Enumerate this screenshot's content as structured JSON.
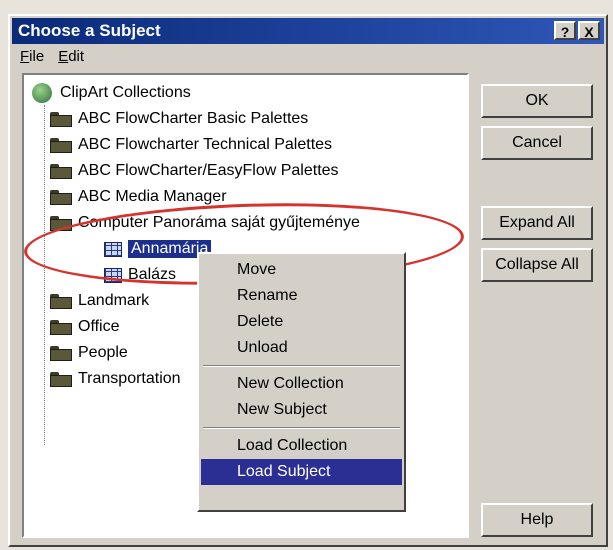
{
  "window": {
    "title": "Choose a Subject",
    "help_btn": "?",
    "close_btn": "X"
  },
  "menu": {
    "file": "File",
    "edit": "Edit"
  },
  "tree": {
    "root": "ClipArt Collections",
    "items": [
      "ABC FlowCharter Basic Palettes",
      "ABC Flowcharter Technical Palettes",
      "ABC FlowCharter/EasyFlow Palettes",
      "ABC Media Manager",
      "Computer Panoráma saját gyűjteménye",
      "Annamária",
      "Balázs",
      "Landmark",
      "Office",
      "People",
      "Transportation"
    ]
  },
  "context_menu": [
    "Move",
    "Rename",
    "Delete",
    "Unload",
    "New Collection",
    "New Subject",
    "Load Collection",
    "Load Subject"
  ],
  "buttons": {
    "ok": "OK",
    "cancel": "Cancel",
    "expand": "Expand All",
    "collapse": "Collapse All",
    "help": "Help"
  }
}
